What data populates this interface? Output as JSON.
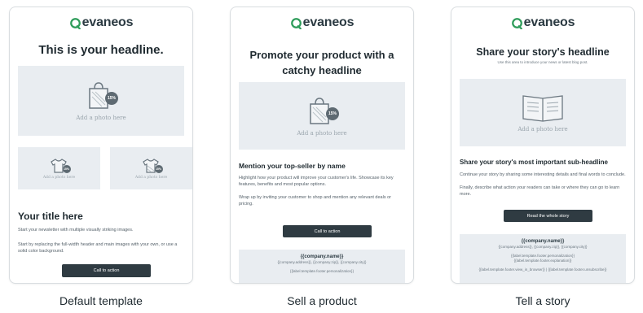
{
  "brand": {
    "name": "evaneos",
    "color": "#2e9c5a"
  },
  "templates": [
    {
      "label": "Default template",
      "headline": "This is your headline.",
      "hero_caption": "Add a photo here",
      "small_caption_left": "Add a photo here",
      "small_caption_right": "Add a photo here",
      "badge": "15%",
      "title": "Your title here",
      "para1": "Start your newsletter with multiple visually striking images.",
      "para2": "Start by replacing the full-width header and main images with your own, or use a solid color background.",
      "cta": "Call to action"
    },
    {
      "label": "Sell a product",
      "headline_line1": "Promote your product with a",
      "headline_line2": "catchy headline",
      "hero_caption": "Add a photo here",
      "badge": "15%",
      "subhead": "Mention your top-seller by name",
      "para1": "Highlight how your product will improve your customer's life. Showcase its key features, benefits and most popular options.",
      "para2": "Wrap up by inviting your customer to shop and mention any relevant deals or pricing.",
      "cta": "Call to action",
      "footer_name": "{{company.name}}",
      "footer_address": "{{company.address}}, {{company.zip}}, {{company.city}}",
      "footer_personalization": "{{label.template.footer.personalization}}"
    },
    {
      "label": "Tell a story",
      "headline": "Share your story's headline",
      "intro": "Use this area to introduce your news or latest blog post.",
      "hero_caption": "Add a photo here",
      "subhead": "Share your story's most important sub-headline",
      "para1": "Continue your story by sharing some interesting details and final words to conclude.",
      "para2": "Finally, describe what action your readers can take or where they can go to learn more.",
      "cta": "Read the whole story",
      "footer_name": "{{company.name}}",
      "footer_address": "{{company.address}}, {{company.zip}}, {{company.city}}",
      "footer_personalization": "{{label.template.footer.personalization}}",
      "footer_explanation": "{{label.template.footer.explanation}}",
      "footer_links": "{{label.template.footer.view_in_browser}} | {{label.template.footer.unsubscribe}}"
    }
  ]
}
